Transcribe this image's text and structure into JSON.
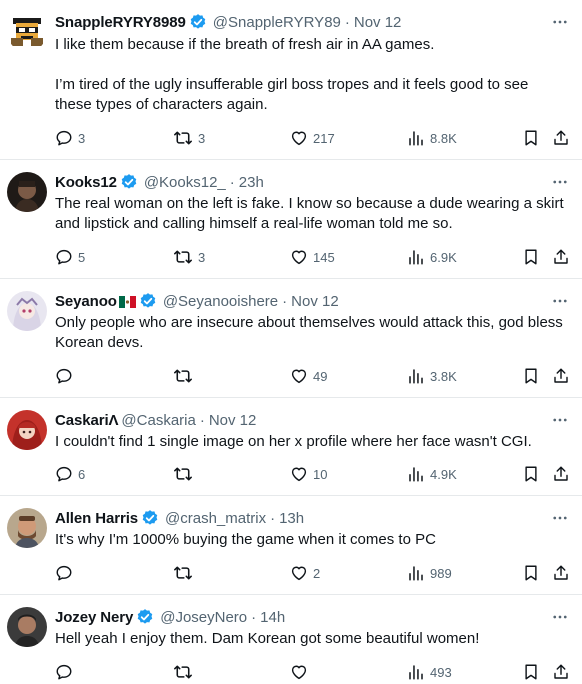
{
  "replies": [
    {
      "name": "SnappleRYRY8989",
      "handle": "@SnappleRYRY89",
      "time": "Nov 12",
      "paragraphs": [
        "I like them because if the breath of fresh air in AA games.",
        "I’m tired of the ugly insufferable girl boss tropes and it feels good to see these types of characters again."
      ],
      "replies_count": "3",
      "reposts": "3",
      "likes": "217",
      "views": "8.8K",
      "verified": true
    },
    {
      "name": "Kooks12",
      "handle": "@Kooks12_",
      "time": "23h",
      "paragraphs": [
        "The real woman on the left is fake. I know so because a dude wearing a skirt and lipstick and calling himself a real-life woman told me so."
      ],
      "replies_count": "5",
      "reposts": "3",
      "likes": "145",
      "views": "6.9K",
      "verified": true
    },
    {
      "name": "Seyanoo",
      "handle": "@Seyanooishere",
      "time": "Nov 12",
      "flag_icon": "mexico-flag-icon",
      "paragraphs": [
        "Only people who are insecure about themselves would attack this, god bless Korean devs."
      ],
      "replies_count": "",
      "reposts": "",
      "likes": "49",
      "views": "3.8K",
      "verified": true
    },
    {
      "name": "CaskariΛ",
      "handle": "@Caskaria",
      "time": "Nov 12",
      "paragraphs": [
        "I couldn't find 1 single image on her x profile where her face wasn't CGI."
      ],
      "replies_count": "6",
      "reposts": "",
      "likes": "10",
      "views": "4.9K",
      "verified": false
    },
    {
      "name": "Allen Harris",
      "handle": "@crash_matrix",
      "time": "13h",
      "paragraphs": [
        "It's why I'm 1000% buying the game when it comes to PC"
      ],
      "replies_count": "",
      "reposts": "",
      "likes": "2",
      "views": "989",
      "verified": true
    },
    {
      "name": "Jozey Nery",
      "handle": "@JoseyNero",
      "time": "14h",
      "paragraphs": [
        "Hell yeah I enjoy them. Dam Korean got some beautiful women!"
      ],
      "replies_count": "",
      "reposts": "",
      "likes": "",
      "views": "493",
      "verified": true
    }
  ],
  "colors": {
    "verified": "#1d9bf0",
    "text": "#0f1419",
    "secondary": "#536471",
    "divider": "#e6e9eb"
  },
  "icons": [
    "reply-icon",
    "repost-icon",
    "like-icon",
    "views-icon",
    "bookmark-icon",
    "share-icon",
    "more-icon",
    "verified-badge-icon"
  ]
}
